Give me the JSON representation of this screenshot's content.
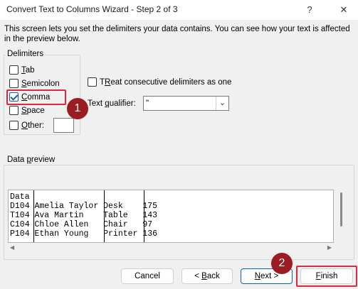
{
  "window": {
    "title": "Convert Text to Columns Wizard - Step 2 of 3",
    "help_glyph": "?",
    "close_glyph": "✕"
  },
  "description": "This screen lets you set the delimiters your data contains.  You can see how your text is affected in the preview below.",
  "delimiters": {
    "legend": "Delimiters",
    "options": [
      {
        "label_u": "T",
        "label_rest": "ab",
        "checked": false
      },
      {
        "label_u": "S",
        "label_rest": "emicolon",
        "checked": false
      },
      {
        "label_u": "C",
        "label_rest": "omma",
        "checked": true
      },
      {
        "label_u": "S",
        "label_rest": "pace",
        "checked": false
      },
      {
        "label_u": "O",
        "label_rest": "ther:",
        "checked": false
      }
    ],
    "other_value": ""
  },
  "treat_consecutive": {
    "label_u": "R",
    "label_pre": "T",
    "label_rest": "eat consecutive delimiters as one",
    "checked": false
  },
  "text_qualifier": {
    "label_pre": "Text ",
    "label_u": "q",
    "label_rest": "ualifier:",
    "value": "\""
  },
  "annotations": {
    "badge1": "1",
    "badge2": "2"
  },
  "preview": {
    "legend_pre": "Data ",
    "legend_u": "p",
    "legend_rest": "review",
    "rows": [
      [
        "Data",
        "",
        "",
        ""
      ],
      [
        "D104",
        "Amelia Taylor",
        "Desk",
        "175"
      ],
      [
        "T104",
        "Ava Martin",
        "Table",
        "143"
      ],
      [
        "C104",
        "Chloe Allen",
        "Chair",
        "97"
      ],
      [
        "P104",
        "Ethan Young",
        "Printer",
        "136"
      ]
    ],
    "text": "Data\nD104 Amelia Taylor Desk    175\nT104 Ava Martin    Table   143\nC104 Chloe Allen   Chair   97\nP104 Ethan Young   Printer 136"
  },
  "buttons": {
    "cancel": "Cancel",
    "back_pre": "< ",
    "back_u": "B",
    "back_rest": "ack",
    "next_u": "N",
    "next_rest": "ext >",
    "finish_u": "F",
    "finish_rest": "inish"
  },
  "colors": {
    "highlight": "#e0283b",
    "badge": "#9b1c23",
    "check": "#1a5fb4",
    "default_button": "#0067c0"
  }
}
